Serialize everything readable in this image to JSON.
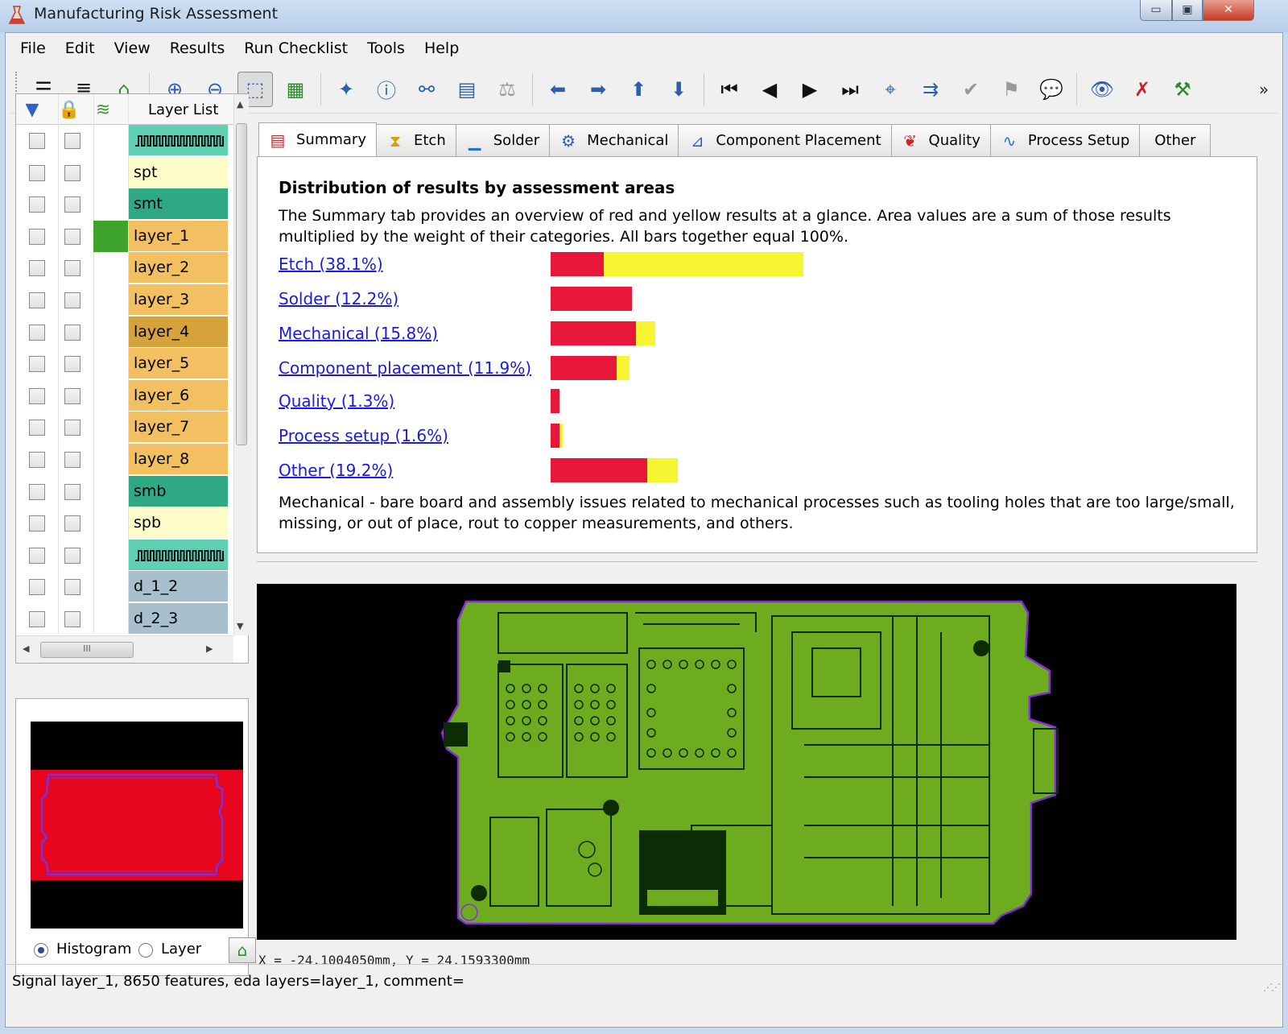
{
  "window": {
    "title": "Manufacturing Risk Assessment",
    "minimize": "▭",
    "maximize": "▣",
    "close": "✕"
  },
  "menu": [
    "File",
    "Edit",
    "View",
    "Results",
    "Run Checklist",
    "Tools",
    "Help"
  ],
  "layer_panel": {
    "header_title": "Layer List",
    "header_icons": [
      "filter-icon",
      "lock-icon",
      "layers-stack-icon"
    ],
    "layers": [
      {
        "name": "",
        "pattern": "connector",
        "color": "#5fd0b4"
      },
      {
        "name": "spt",
        "color": "#fdfcc8"
      },
      {
        "name": "smt",
        "color": "#2fa884"
      },
      {
        "name": "layer_1",
        "color": "#f3c061",
        "visible_color": "#3ea32a"
      },
      {
        "name": "layer_2",
        "color": "#f3c061"
      },
      {
        "name": "layer_3",
        "color": "#f3c061"
      },
      {
        "name": "layer_4",
        "color": "#d6a23b"
      },
      {
        "name": "layer_5",
        "color": "#f3c061"
      },
      {
        "name": "layer_6",
        "color": "#f3c061"
      },
      {
        "name": "layer_7",
        "color": "#f3c061"
      },
      {
        "name": "layer_8",
        "color": "#f3c061"
      },
      {
        "name": "smb",
        "color": "#2fa884"
      },
      {
        "name": "spb",
        "color": "#fdfcc8"
      },
      {
        "name": "",
        "pattern": "connector",
        "color": "#5fd0b4"
      },
      {
        "name": "d_1_2",
        "color": "#a8bfce"
      },
      {
        "name": "d_2_3",
        "color": "#a8bfce"
      }
    ]
  },
  "preview": {
    "option_histogram": "Histogram",
    "option_layer": "Layer",
    "selected": "Histogram"
  },
  "tabs": [
    {
      "label": "Summary",
      "icon": "summary-bars-icon",
      "active": true
    },
    {
      "label": "Etch",
      "icon": "etch-icon"
    },
    {
      "label": "Solder",
      "icon": "solder-icon"
    },
    {
      "label": "Mechanical",
      "icon": "mechanical-icon"
    },
    {
      "label": "Component Placement",
      "icon": "component-placement-icon"
    },
    {
      "label": "Quality",
      "icon": "quality-icon"
    },
    {
      "label": "Process Setup",
      "icon": "process-setup-icon"
    },
    {
      "label": "Other",
      "icon": ""
    }
  ],
  "summary": {
    "heading": "Distribution of results by assessment areas",
    "description": "The Summary tab provides an overview of red and yellow results at a glance.   Area values are a sum of those results multiplied by the weight of their categories.   All bars together equal 100%.",
    "bar_scale_max_percent": 38.1,
    "areas": [
      {
        "label": "Etch (38.1%)",
        "total": 38.1,
        "red": 8.0
      },
      {
        "label": "Solder (12.2%)",
        "total": 12.2,
        "red": 12.2
      },
      {
        "label": "Mechanical (15.8%)",
        "total": 15.8,
        "red": 12.9
      },
      {
        "label": "Component placement (11.9%)",
        "total": 11.9,
        "red": 10.0
      },
      {
        "label": "Quality (1.3%)",
        "total": 1.3,
        "red": 1.3
      },
      {
        "label": "Process setup (1.6%)",
        "total": 1.6,
        "red": 1.3
      },
      {
        "label": "Other (19.2%)",
        "total": 19.2,
        "red": 14.5
      }
    ],
    "note": "Mechanical - bare board and assembly issues related to mechanical processes such as tooling holes that are too large/small, missing, or out of place, rout to copper measurements, and others.",
    "colors": {
      "red": "#e8173a",
      "yellow": "#f7f532"
    }
  },
  "board": {
    "coord_readout": "X = -24.1004050mm, Y = 24.1593300mm",
    "board_color": "#6dab1f",
    "outline_color": "#8a2be2"
  },
  "status": "Signal layer_1, 8650 features, eda layers=layer_1, comment="
}
